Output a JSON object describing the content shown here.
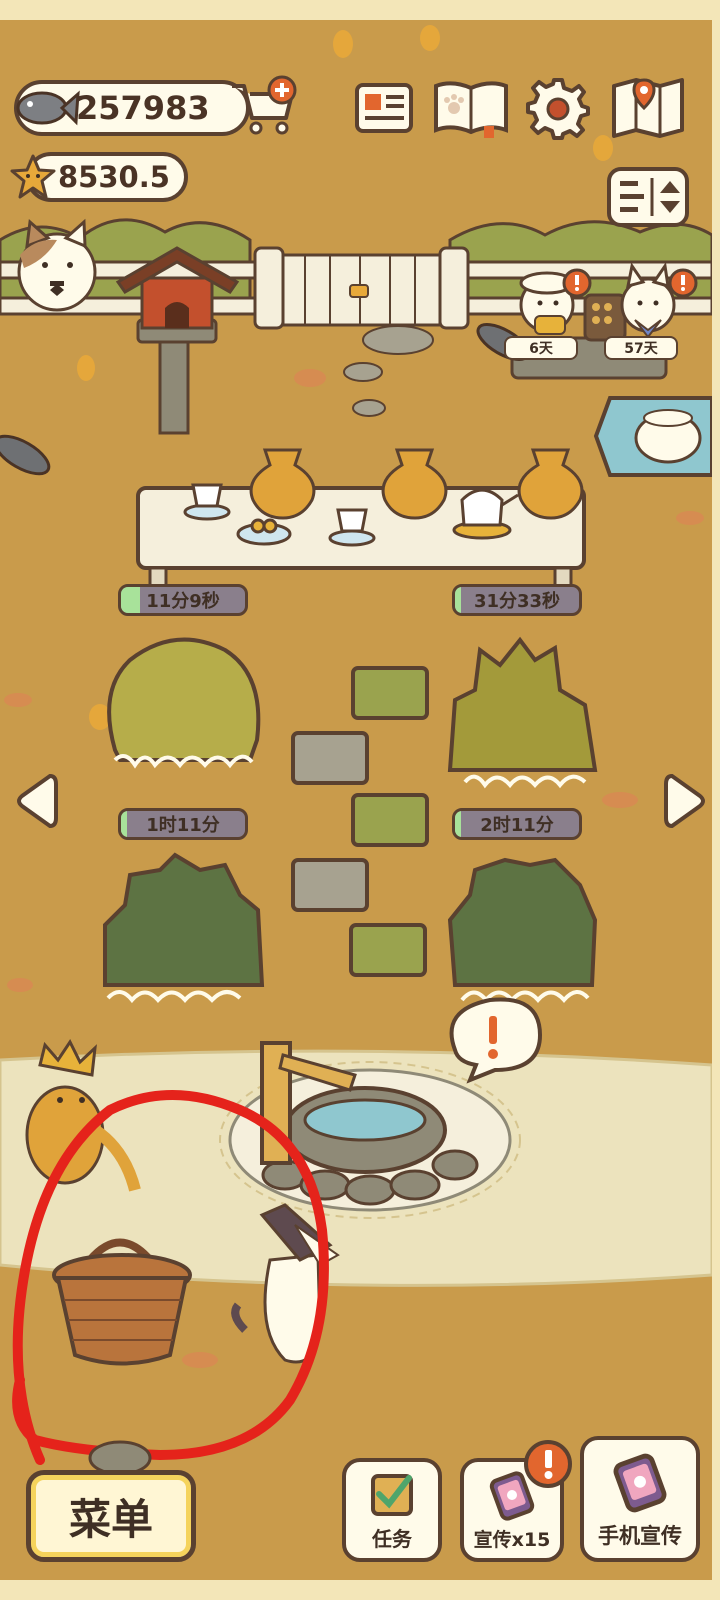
{
  "currency": {
    "fish": "257983",
    "stars": "8530.5"
  },
  "top_icons": [
    "shop-cart-icon",
    "newspaper-icon",
    "paw-book-icon",
    "settings-gear-icon",
    "map-icon",
    "sort-toggle-icon"
  ],
  "visitors": [
    {
      "name": "chef-cat",
      "days": "6天"
    },
    {
      "name": "white-cat",
      "days": "57天"
    }
  ],
  "timers": [
    {
      "label": "11分9秒",
      "progress": 0.15
    },
    {
      "label": "31分33秒",
      "progress": 0.05
    },
    {
      "label": "1时11分",
      "progress": 0.05
    },
    {
      "label": "2时11分",
      "progress": 0.05
    }
  ],
  "bottom": {
    "menu_label": "菜单",
    "tasks_label": "任务",
    "promo_label": "宣传x15",
    "phone_promo_label": "手机宣传"
  },
  "colors": {
    "ground": "#c99b4b",
    "fence": "#f5efdc",
    "hedge": "#9aa34e",
    "path": "#ece3bd",
    "outline": "#5a4130",
    "progress_green": "#a8e29a",
    "annotation_red": "#e5231b"
  }
}
